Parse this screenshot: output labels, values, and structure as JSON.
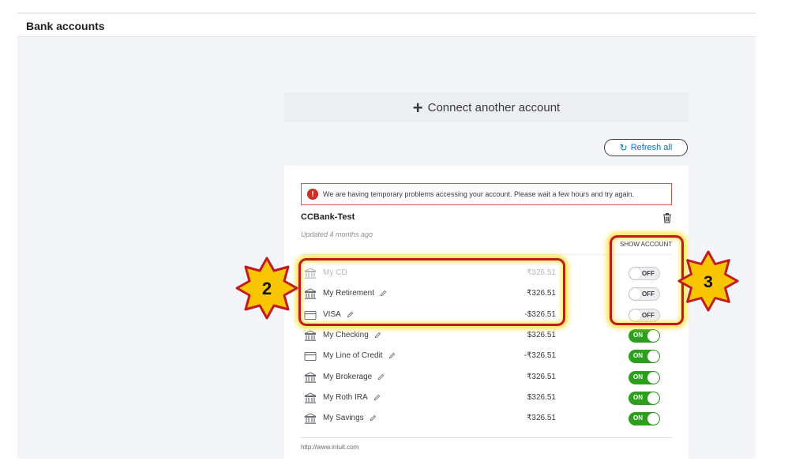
{
  "header": {
    "title": "Bank accounts"
  },
  "connect": {
    "label": "Connect another account"
  },
  "refresh": {
    "label": "Refresh all"
  },
  "alert": {
    "message": "We are having temporary problems accessing your account. Please wait a few hours and try again."
  },
  "bank": {
    "name": "CCBank-Test",
    "updated": "Updated 4 months ago",
    "show_account_label": "SHOW ACCOUNT"
  },
  "accounts": [
    {
      "name": "My CD",
      "amount": "₹326.51",
      "icon": "bank-icon",
      "toggle": "OFF",
      "dim": true,
      "editable": false
    },
    {
      "name": "My Retirement",
      "amount": "₹326.51",
      "icon": "bank-icon",
      "toggle": "OFF",
      "dim": false,
      "editable": true
    },
    {
      "name": "VISA",
      "amount": "-$326.51",
      "icon": "credit-card-icon",
      "toggle": "OFF",
      "dim": false,
      "editable": true
    },
    {
      "name": "My Checking",
      "amount": "$326.51",
      "icon": "bank-icon",
      "toggle": "ON",
      "dim": false,
      "editable": true
    },
    {
      "name": "My Line of Credit",
      "amount": "-₹326.51",
      "icon": "credit-card-icon",
      "toggle": "ON",
      "dim": false,
      "editable": true
    },
    {
      "name": "My Brokerage",
      "amount": "₹326.51",
      "icon": "bank-icon",
      "toggle": "ON",
      "dim": false,
      "editable": true
    },
    {
      "name": "My Roth IRA",
      "amount": "$326.51",
      "icon": "bank-icon",
      "toggle": "ON",
      "dim": false,
      "editable": true
    },
    {
      "name": "My Savings",
      "amount": "₹326.51",
      "icon": "bank-icon",
      "toggle": "ON",
      "dim": false,
      "editable": true
    }
  ],
  "footer": {
    "url": "http://www.intuit.com"
  },
  "callouts": [
    {
      "label": "2"
    },
    {
      "label": "3"
    }
  ],
  "colors": {
    "on_green": "#2ca01c",
    "link_blue": "#0077c5",
    "alert_red": "#d52b1e",
    "highlight_red": "#c0191e",
    "star_yellow": "#f7c600"
  }
}
